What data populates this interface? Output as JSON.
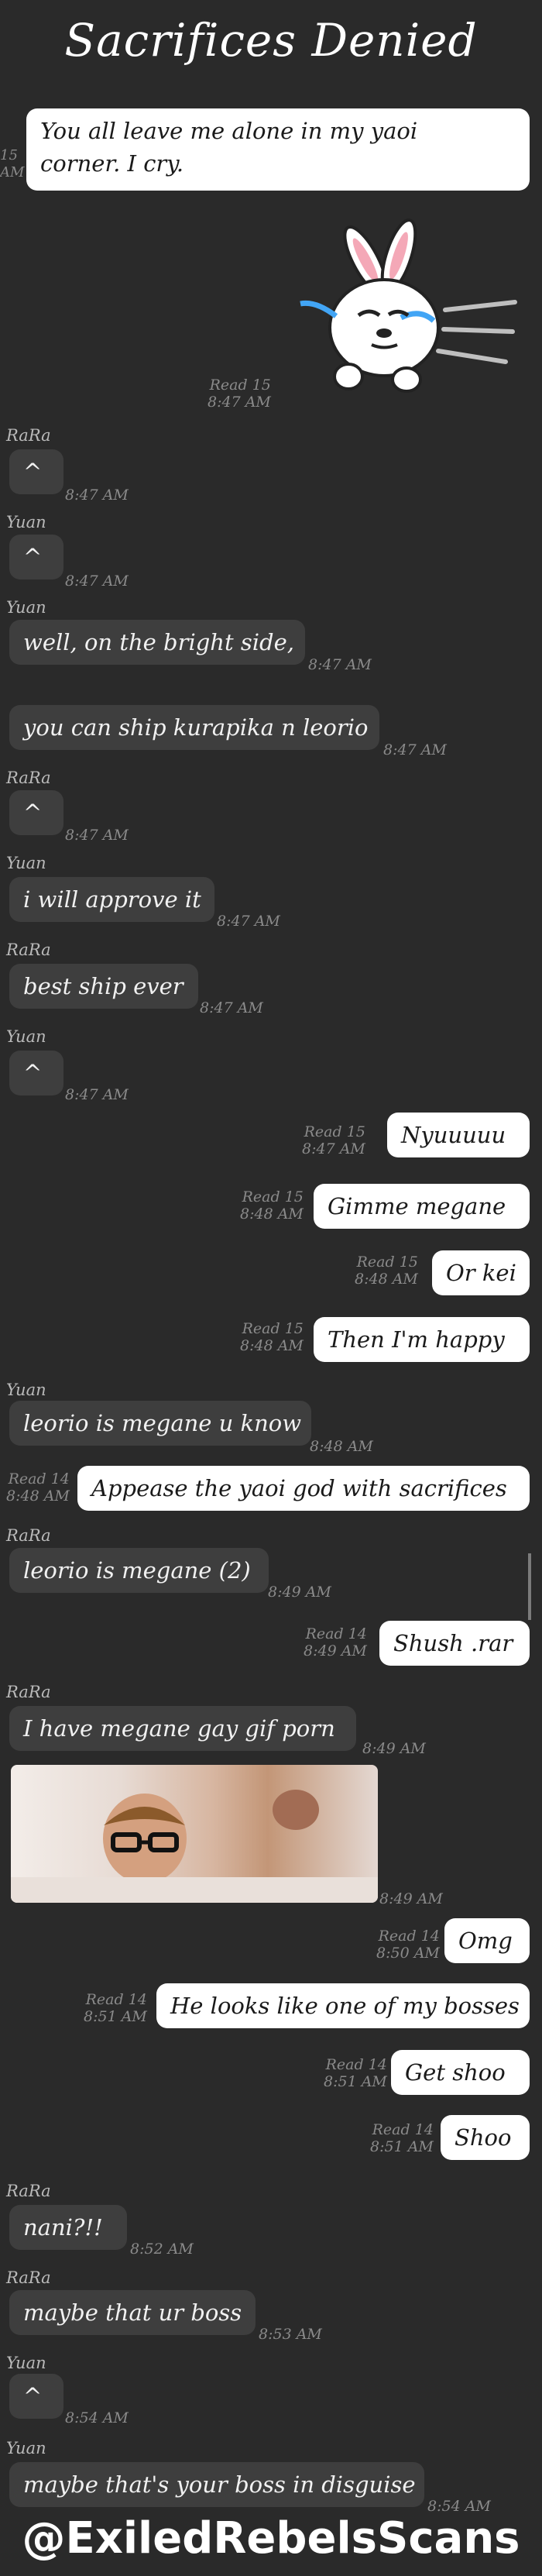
{
  "title": "Sacrifices Denied",
  "edge_meta": "15\nAM",
  "messages": [
    {
      "sender": "",
      "text": "You all leave me alone in my yaoi\ncorner. I cry.",
      "side": "out",
      "meta": ""
    },
    {
      "sender": "",
      "text": "",
      "side": "sticker",
      "meta": "Read 15\n8:47 AM"
    },
    {
      "sender": "RaRa",
      "text": "^",
      "side": "in",
      "meta": "8:47 AM"
    },
    {
      "sender": "Yuan",
      "text": "^",
      "side": "in",
      "meta": "8:47 AM"
    },
    {
      "sender": "Yuan",
      "text": "well, on the bright side,",
      "side": "in",
      "meta": "8:47 AM"
    },
    {
      "sender": "",
      "text": "you can ship kurapika n leorio",
      "side": "in",
      "meta": "8:47 AM"
    },
    {
      "sender": "RaRa",
      "text": "^",
      "side": "in",
      "meta": "8:47 AM"
    },
    {
      "sender": "Yuan",
      "text": "i will approve it",
      "side": "in",
      "meta": "8:47 AM"
    },
    {
      "sender": "RaRa",
      "text": "best ship ever",
      "side": "in",
      "meta": "8:47 AM"
    },
    {
      "sender": "Yuan",
      "text": "^",
      "side": "in",
      "meta": "8:47 AM"
    },
    {
      "sender": "",
      "text": "Nyuuuuu",
      "side": "out",
      "meta": "Read 15\n8:47 AM"
    },
    {
      "sender": "",
      "text": "Gimme megane",
      "side": "out",
      "meta": "Read 15\n8:48 AM"
    },
    {
      "sender": "",
      "text": "Or kei",
      "side": "out",
      "meta": "Read 15\n8:48 AM"
    },
    {
      "sender": "",
      "text": "Then I'm happy",
      "side": "out",
      "meta": "Read 15\n8:48 AM"
    },
    {
      "sender": "Yuan",
      "text": "leorio is megane u know",
      "side": "in",
      "meta": "8:48 AM"
    },
    {
      "sender": "",
      "text": "Appease the yaoi god with sacrifices",
      "side": "out",
      "meta": "Read 14\n8:48 AM"
    },
    {
      "sender": "RaRa",
      "text": "leorio is megane (2)",
      "side": "in",
      "meta": "8:49 AM"
    },
    {
      "sender": "",
      "text": "Shush .rar",
      "side": "out",
      "meta": "Read 14\n8:49 AM"
    },
    {
      "sender": "RaRa",
      "text": "I have megane gay gif porn",
      "side": "in",
      "meta": "8:49 AM"
    },
    {
      "sender": "",
      "text": "",
      "side": "photo",
      "meta": "8:49 AM"
    },
    {
      "sender": "",
      "text": "Omg",
      "side": "out",
      "meta": "Read 14\n8:50 AM"
    },
    {
      "sender": "",
      "text": "He looks like one of my bosses",
      "side": "out",
      "meta": "Read 14\n8:51 AM"
    },
    {
      "sender": "",
      "text": "Get shoo",
      "side": "out",
      "meta": "Read 14\n8:51 AM"
    },
    {
      "sender": "",
      "text": "Shoo",
      "side": "out",
      "meta": "Read 14\n8:51 AM"
    },
    {
      "sender": "RaRa",
      "text": "nani?!!",
      "side": "in",
      "meta": "8:52 AM"
    },
    {
      "sender": "RaRa",
      "text": "maybe that ur boss",
      "side": "in",
      "meta": "8:53 AM"
    },
    {
      "sender": "Yuan",
      "text": "^",
      "side": "in",
      "meta": "8:54 AM"
    },
    {
      "sender": "Yuan",
      "text": "maybe that's your boss in disguise",
      "side": "in",
      "meta": "8:54 AM"
    }
  ],
  "footer": "@ExiledRebelsScans",
  "colors": {
    "background": "#2a2a2a",
    "incoming": "#3e3e3e",
    "outgoing": "#ffffff",
    "meta": "#8a8a8a"
  }
}
